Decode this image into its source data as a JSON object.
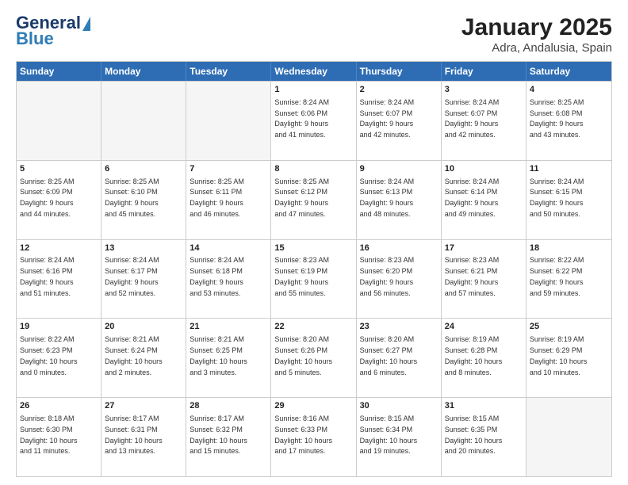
{
  "header": {
    "logo_line1": "General",
    "logo_line2": "Blue",
    "title": "January 2025",
    "subtitle": "Adra, Andalusia, Spain"
  },
  "weekdays": [
    "Sunday",
    "Monday",
    "Tuesday",
    "Wednesday",
    "Thursday",
    "Friday",
    "Saturday"
  ],
  "weeks": [
    [
      {
        "day": "",
        "info": ""
      },
      {
        "day": "",
        "info": ""
      },
      {
        "day": "",
        "info": ""
      },
      {
        "day": "1",
        "info": "Sunrise: 8:24 AM\nSunset: 6:06 PM\nDaylight: 9 hours\nand 41 minutes."
      },
      {
        "day": "2",
        "info": "Sunrise: 8:24 AM\nSunset: 6:07 PM\nDaylight: 9 hours\nand 42 minutes."
      },
      {
        "day": "3",
        "info": "Sunrise: 8:24 AM\nSunset: 6:07 PM\nDaylight: 9 hours\nand 42 minutes."
      },
      {
        "day": "4",
        "info": "Sunrise: 8:25 AM\nSunset: 6:08 PM\nDaylight: 9 hours\nand 43 minutes."
      }
    ],
    [
      {
        "day": "5",
        "info": "Sunrise: 8:25 AM\nSunset: 6:09 PM\nDaylight: 9 hours\nand 44 minutes."
      },
      {
        "day": "6",
        "info": "Sunrise: 8:25 AM\nSunset: 6:10 PM\nDaylight: 9 hours\nand 45 minutes."
      },
      {
        "day": "7",
        "info": "Sunrise: 8:25 AM\nSunset: 6:11 PM\nDaylight: 9 hours\nand 46 minutes."
      },
      {
        "day": "8",
        "info": "Sunrise: 8:25 AM\nSunset: 6:12 PM\nDaylight: 9 hours\nand 47 minutes."
      },
      {
        "day": "9",
        "info": "Sunrise: 8:24 AM\nSunset: 6:13 PM\nDaylight: 9 hours\nand 48 minutes."
      },
      {
        "day": "10",
        "info": "Sunrise: 8:24 AM\nSunset: 6:14 PM\nDaylight: 9 hours\nand 49 minutes."
      },
      {
        "day": "11",
        "info": "Sunrise: 8:24 AM\nSunset: 6:15 PM\nDaylight: 9 hours\nand 50 minutes."
      }
    ],
    [
      {
        "day": "12",
        "info": "Sunrise: 8:24 AM\nSunset: 6:16 PM\nDaylight: 9 hours\nand 51 minutes."
      },
      {
        "day": "13",
        "info": "Sunrise: 8:24 AM\nSunset: 6:17 PM\nDaylight: 9 hours\nand 52 minutes."
      },
      {
        "day": "14",
        "info": "Sunrise: 8:24 AM\nSunset: 6:18 PM\nDaylight: 9 hours\nand 53 minutes."
      },
      {
        "day": "15",
        "info": "Sunrise: 8:23 AM\nSunset: 6:19 PM\nDaylight: 9 hours\nand 55 minutes."
      },
      {
        "day": "16",
        "info": "Sunrise: 8:23 AM\nSunset: 6:20 PM\nDaylight: 9 hours\nand 56 minutes."
      },
      {
        "day": "17",
        "info": "Sunrise: 8:23 AM\nSunset: 6:21 PM\nDaylight: 9 hours\nand 57 minutes."
      },
      {
        "day": "18",
        "info": "Sunrise: 8:22 AM\nSunset: 6:22 PM\nDaylight: 9 hours\nand 59 minutes."
      }
    ],
    [
      {
        "day": "19",
        "info": "Sunrise: 8:22 AM\nSunset: 6:23 PM\nDaylight: 10 hours\nand 0 minutes."
      },
      {
        "day": "20",
        "info": "Sunrise: 8:21 AM\nSunset: 6:24 PM\nDaylight: 10 hours\nand 2 minutes."
      },
      {
        "day": "21",
        "info": "Sunrise: 8:21 AM\nSunset: 6:25 PM\nDaylight: 10 hours\nand 3 minutes."
      },
      {
        "day": "22",
        "info": "Sunrise: 8:20 AM\nSunset: 6:26 PM\nDaylight: 10 hours\nand 5 minutes."
      },
      {
        "day": "23",
        "info": "Sunrise: 8:20 AM\nSunset: 6:27 PM\nDaylight: 10 hours\nand 6 minutes."
      },
      {
        "day": "24",
        "info": "Sunrise: 8:19 AM\nSunset: 6:28 PM\nDaylight: 10 hours\nand 8 minutes."
      },
      {
        "day": "25",
        "info": "Sunrise: 8:19 AM\nSunset: 6:29 PM\nDaylight: 10 hours\nand 10 minutes."
      }
    ],
    [
      {
        "day": "26",
        "info": "Sunrise: 8:18 AM\nSunset: 6:30 PM\nDaylight: 10 hours\nand 11 minutes."
      },
      {
        "day": "27",
        "info": "Sunrise: 8:17 AM\nSunset: 6:31 PM\nDaylight: 10 hours\nand 13 minutes."
      },
      {
        "day": "28",
        "info": "Sunrise: 8:17 AM\nSunset: 6:32 PM\nDaylight: 10 hours\nand 15 minutes."
      },
      {
        "day": "29",
        "info": "Sunrise: 8:16 AM\nSunset: 6:33 PM\nDaylight: 10 hours\nand 17 minutes."
      },
      {
        "day": "30",
        "info": "Sunrise: 8:15 AM\nSunset: 6:34 PM\nDaylight: 10 hours\nand 19 minutes."
      },
      {
        "day": "31",
        "info": "Sunrise: 8:15 AM\nSunset: 6:35 PM\nDaylight: 10 hours\nand 20 minutes."
      },
      {
        "day": "",
        "info": ""
      }
    ]
  ]
}
